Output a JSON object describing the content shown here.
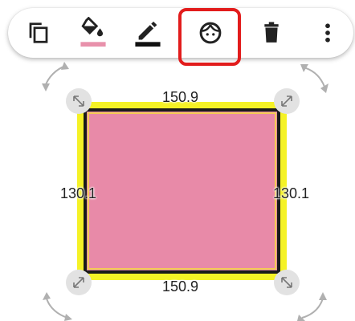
{
  "toolbar": {
    "tools": [
      {
        "name": "copy-icon"
      },
      {
        "name": "fill-color-icon",
        "color": "#e891ab"
      },
      {
        "name": "stroke-color-icon",
        "color": "#111111"
      },
      {
        "name": "sticker-face-icon",
        "highlighted": true
      },
      {
        "name": "delete-icon"
      },
      {
        "name": "more-vert-icon"
      }
    ],
    "highlight_color": "#e21c1c"
  },
  "shape": {
    "type": "rectangle",
    "fill_color": "#e88aa8",
    "stroke_color": "#1a1a1a",
    "selection_glow_color": "#f3f000",
    "dimensions": {
      "top": "150.9",
      "bottom": "150.9",
      "left": "130.1",
      "right": "130.1"
    }
  }
}
